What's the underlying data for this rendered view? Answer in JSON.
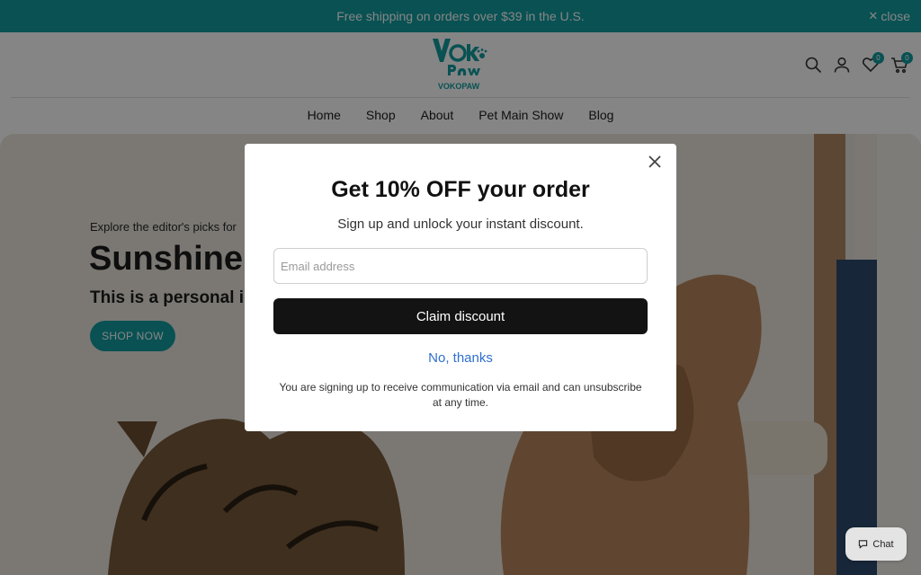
{
  "announcement": {
    "text": "Free shipping on orders over $39 in the U.S.",
    "close_label": "close"
  },
  "header": {
    "logo_alt": "VOKOPAW",
    "icons": [
      "search-icon",
      "account-icon",
      "wishlist-icon",
      "cart-icon"
    ],
    "wishlist_count": "0",
    "cart_count": "0"
  },
  "nav": {
    "items": [
      "Home",
      "Shop",
      "About",
      "Pet Main Show",
      "Blog"
    ]
  },
  "hero": {
    "eyebrow": "Explore the editor's picks for",
    "title": "Sunshine,",
    "subtitle": "This is a personal in",
    "button": "SHOP NOW"
  },
  "popup": {
    "title": "Get 10% OFF your order",
    "subtitle": "Sign up and unlock your instant discount.",
    "email_placeholder": "Email address",
    "email_value": "",
    "claim_button": "Claim discount",
    "decline_link": "No, thanks",
    "disclaimer": "You are signing up to receive communication via email and can unsubscribe at any time."
  },
  "chat": {
    "label": "Chat"
  },
  "colors": {
    "brand_teal": "#139ca0",
    "button_dark": "#131313",
    "link_blue": "#2f6fd0"
  }
}
